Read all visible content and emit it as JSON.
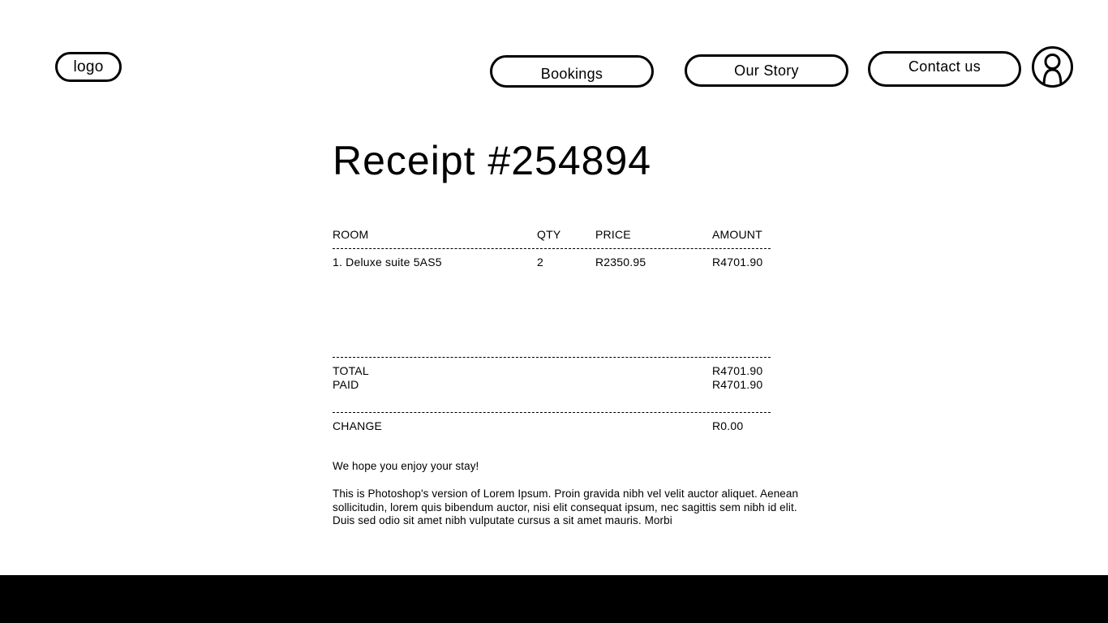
{
  "header": {
    "logo_label": "logo",
    "nav": {
      "bookings": "Bookings",
      "our_story": "Our Story",
      "contact": "Contact us"
    },
    "avatar_icon": "user-icon"
  },
  "receipt": {
    "title": "Receipt #254894",
    "columns": {
      "room": "ROOM",
      "qty": "QTY",
      "price": "PRICE",
      "amount": "AMOUNT"
    },
    "items": [
      {
        "room": "1. Deluxe suite 5AS5",
        "qty": "2",
        "price": "R2350.95",
        "amount": "R4701.90"
      }
    ],
    "totals": {
      "total_label": "TOTAL",
      "total_value": "R4701.90",
      "paid_label": "PAID",
      "paid_value": "R4701.90",
      "change_label": "CHANGE",
      "change_value": "R0.00"
    },
    "message": "We hope you enjoy your stay!",
    "lorem": "This is Photoshop's version of Lorem Ipsum. Proin gravida nibh vel velit auctor aliquet. Aenean sollicitudin, lorem quis bibendum auctor, nisi elit consequat ipsum, nec sagittis sem nibh id elit. Duis sed odio sit amet nibh vulputate cursus a sit amet mauris. Morbi"
  },
  "colors": {
    "background": "#ffffff",
    "ink": "#000000",
    "footer": "#000000"
  }
}
